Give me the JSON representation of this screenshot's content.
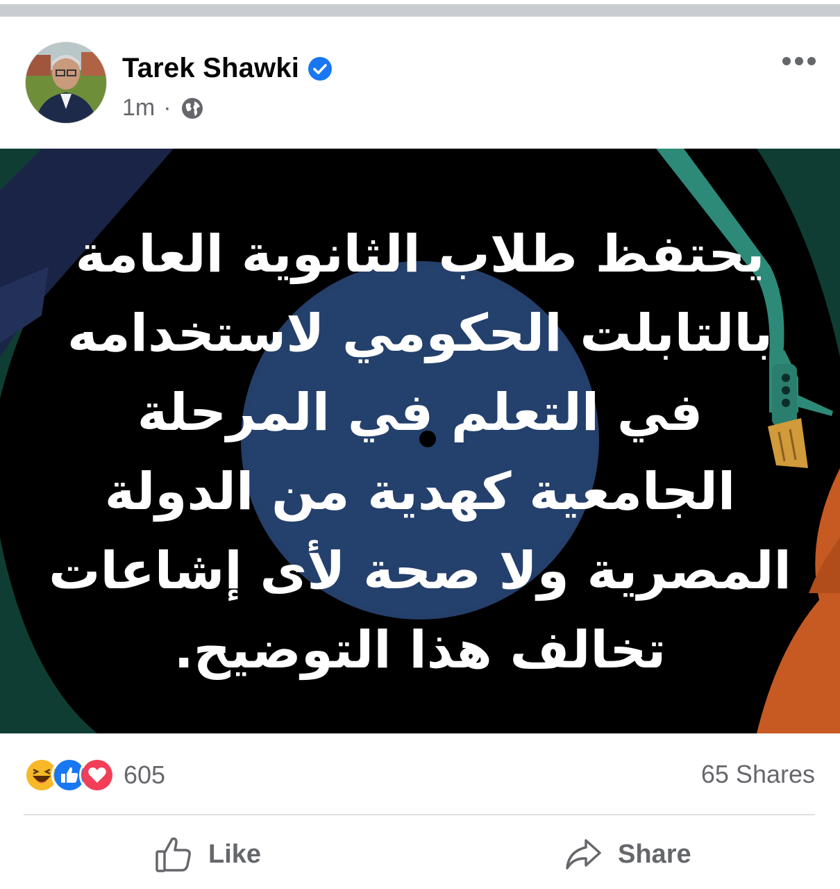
{
  "post": {
    "author": "Tarek Shawki",
    "time": "1m",
    "separator": "·",
    "image_text": "يحتفظ طلاب الثانوية العامة\nبالتابلت الحكومي لاستخدامه\nفي التعلم في المرحلة\nالجامعية كهدية من الدولة\nالمصرية ولا صحة لأى إشاعات\nتخالف هذا التوضيح."
  },
  "stats": {
    "reaction_count": "605",
    "shares": "65 Shares",
    "reactions": [
      "haha",
      "like",
      "love"
    ]
  },
  "actions": {
    "like_label": "Like",
    "share_label": "Share"
  },
  "colors": {
    "verified_blue": "#1877f2",
    "secondary_text": "#65676b",
    "image_disc_blue": "#253f6b",
    "image_arm_teal": "#2e8a78",
    "image_orange": "#c65a22"
  },
  "icons": [
    "verified-badge-icon",
    "globe-icon",
    "more-options-icon",
    "like-thumb-icon",
    "share-arrow-icon"
  ]
}
